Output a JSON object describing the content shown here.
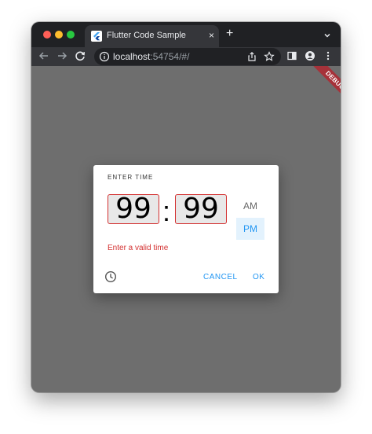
{
  "browser": {
    "tab_title": "Flutter Code Sample",
    "tab_close": "×",
    "new_tab": "+",
    "url_host": "localhost",
    "url_rest": ":54754/#/"
  },
  "app": {
    "debug_banner": "DEBUG"
  },
  "dialog": {
    "help_text": "ENTER TIME",
    "hour_value": "99",
    "separator": ":",
    "minute_value": "99",
    "am_label": "AM",
    "pm_label": "PM",
    "selected_period": "PM",
    "error_text": "Enter a valid time",
    "cancel_label": "CANCEL",
    "ok_label": "OK"
  },
  "colors": {
    "scrim": "#6e6e6e",
    "error": "#d32f2f",
    "accent": "#2196f3",
    "accent_bg": "#e3f2fd",
    "browser_frame": "#202124",
    "toolbar": "#35363a"
  },
  "icons": {
    "tab_favicon": "flutter-logo-icon",
    "back": "back-arrow-icon",
    "forward": "forward-arrow-icon",
    "reload": "reload-icon",
    "info": "info-icon",
    "share": "share-icon",
    "bookmark": "star-icon",
    "sidepanel": "side-panel-icon",
    "profile": "profile-icon",
    "menu": "kebab-menu-icon",
    "mode_toggle": "clock-icon"
  }
}
